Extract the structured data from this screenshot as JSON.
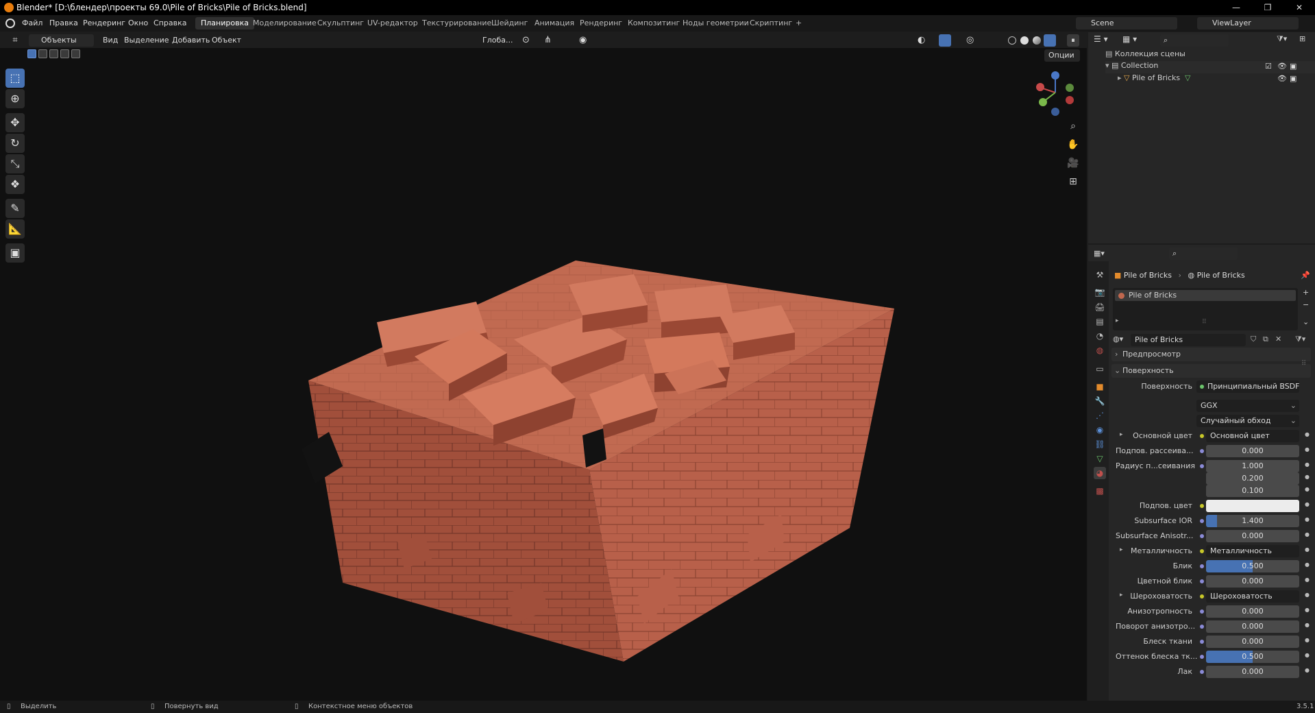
{
  "window": {
    "title": "Blender* [D:\\блендер\\проекты 69.0\\Pile of Bricks\\Pile of Bricks.blend]",
    "min": "—",
    "max": "❐",
    "close": "✕"
  },
  "menu": [
    "Файл",
    "Правка",
    "Рендеринг",
    "Окно",
    "Справка"
  ],
  "workspaces": {
    "items": [
      "Планировка",
      "Моделирование",
      "Скульптинг",
      "UV-редактор",
      "Текстурирование",
      "Шейдинг",
      "Анимация",
      "Рендеринг",
      "Композитинг",
      "Ноды геометрии",
      "Скриптинг"
    ],
    "add": "+"
  },
  "scene": {
    "name": "Scene",
    "view_layer": "ViewLayer"
  },
  "viewport_header": {
    "mode": "Объекты",
    "menus": [
      "Вид",
      "Выделение",
      "Добавить",
      "Объект"
    ],
    "orientation": "Глоба...",
    "options": "Опции"
  },
  "outliner": {
    "root": "Коллекция сцены",
    "collection": "Collection",
    "object": "Pile of Bricks"
  },
  "properties": {
    "breadcrumb": [
      "Pile of Bricks",
      "Pile of Bricks"
    ],
    "slot": "Pile of Bricks",
    "material_name": "Pile of Bricks",
    "panel_preview": "Предпросмотр",
    "panel_surface": "Поверхность",
    "surface_label": "Поверхность",
    "surface_value": "Принципиальный BSDF",
    "distribution": "GGX",
    "subsurface_method": "Случайный обход",
    "rows": [
      {
        "label": "Основной цвет",
        "type": "node",
        "value": "Основной цвет",
        "arrow": true
      },
      {
        "label": "Подпов. рассеива...",
        "type": "num",
        "value": "0.000",
        "fill": 0
      },
      {
        "label": "Радиус п...сеивания",
        "type": "num",
        "value": "1.000",
        "fill": 0
      },
      {
        "label": "",
        "type": "num",
        "value": "0.200",
        "fill": 0
      },
      {
        "label": "",
        "type": "num",
        "value": "0.100",
        "fill": 0
      },
      {
        "label": "Подпов. цвет",
        "type": "color",
        "value": ""
      },
      {
        "label": "Subsurface IOR",
        "type": "num",
        "value": "1.400",
        "fill": 0.12
      },
      {
        "label": "Subsurface Anisotr...",
        "type": "num",
        "value": "0.000",
        "fill": 0
      },
      {
        "label": "Металличность",
        "type": "node",
        "value": "Металличность",
        "arrow": true
      },
      {
        "label": "Блик",
        "type": "num",
        "value": "0.500",
        "fill": 0.5
      },
      {
        "label": "Цветной блик",
        "type": "num",
        "value": "0.000",
        "fill": 0
      },
      {
        "label": "Шероховатость",
        "type": "node",
        "value": "Шероховатость",
        "arrow": true
      },
      {
        "label": "Анизотропность",
        "type": "num",
        "value": "0.000",
        "fill": 0
      },
      {
        "label": "Поворот анизотро...",
        "type": "num",
        "value": "0.000",
        "fill": 0
      },
      {
        "label": "Блеск ткани",
        "type": "num",
        "value": "0.000",
        "fill": 0
      },
      {
        "label": "Оттенок блеска тк...",
        "type": "num",
        "value": "0.500",
        "fill": 0.5
      },
      {
        "label": "Лак",
        "type": "num",
        "value": "0.000",
        "fill": 0
      }
    ]
  },
  "status": {
    "select": "Выделить",
    "rotate": "Повернуть вид",
    "context": "Контекстное меню объектов",
    "version": "3.5.1"
  },
  "colors": {
    "accent": "#4772b3",
    "brick": "#c0674e",
    "bg": "#101010"
  }
}
